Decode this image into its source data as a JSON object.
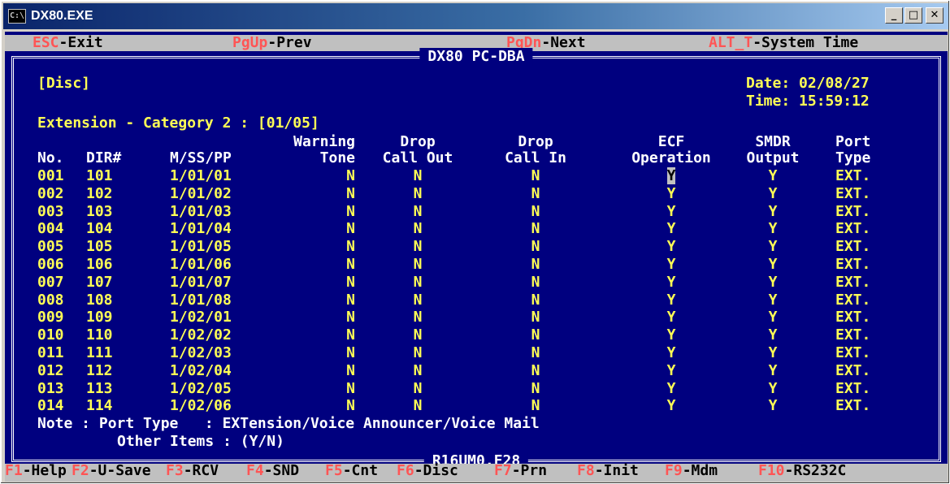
{
  "window": {
    "title": "DX80.EXE",
    "icon": "C:\\"
  },
  "menu": {
    "esc": {
      "key": "ESC",
      "label": "-Exit"
    },
    "pgup": {
      "key": "PgUp",
      "label": "-Prev"
    },
    "pgdn": {
      "key": "PgDn",
      "label": "-Next"
    },
    "alt": {
      "key": "ALT_T",
      "label": "-System Time"
    }
  },
  "screen": {
    "title": "DX80 PC-DBA",
    "mode": "[Disc]",
    "date_label": "Date:",
    "date": "02/08/27",
    "time_label": "Time:",
    "time": "15:59:12",
    "section": "Extension - Category 2 : [01/05]",
    "footer_file": "R16UM0.F28"
  },
  "table": {
    "headers_top": [
      "",
      "",
      "",
      "Warning",
      "Drop",
      "Drop",
      "ECF",
      "SMDR",
      "Port"
    ],
    "headers_bottom": [
      "No.",
      "DIR#",
      "M/SS/PP",
      "Tone",
      "Call Out",
      "Call In",
      "Operation",
      "Output",
      "Type"
    ],
    "rows": [
      [
        "001",
        "101",
        "1/01/01",
        "N",
        "N",
        "N",
        "Y",
        "Y",
        "EXT."
      ],
      [
        "002",
        "102",
        "1/01/02",
        "N",
        "N",
        "N",
        "Y",
        "Y",
        "EXT."
      ],
      [
        "003",
        "103",
        "1/01/03",
        "N",
        "N",
        "N",
        "Y",
        "Y",
        "EXT."
      ],
      [
        "004",
        "104",
        "1/01/04",
        "N",
        "N",
        "N",
        "Y",
        "Y",
        "EXT."
      ],
      [
        "005",
        "105",
        "1/01/05",
        "N",
        "N",
        "N",
        "Y",
        "Y",
        "EXT."
      ],
      [
        "006",
        "106",
        "1/01/06",
        "N",
        "N",
        "N",
        "Y",
        "Y",
        "EXT."
      ],
      [
        "007",
        "107",
        "1/01/07",
        "N",
        "N",
        "N",
        "Y",
        "Y",
        "EXT."
      ],
      [
        "008",
        "108",
        "1/01/08",
        "N",
        "N",
        "N",
        "Y",
        "Y",
        "EXT."
      ],
      [
        "009",
        "109",
        "1/02/01",
        "N",
        "N",
        "N",
        "Y",
        "Y",
        "EXT."
      ],
      [
        "010",
        "110",
        "1/02/02",
        "N",
        "N",
        "N",
        "Y",
        "Y",
        "EXT."
      ],
      [
        "011",
        "111",
        "1/02/03",
        "N",
        "N",
        "N",
        "Y",
        "Y",
        "EXT."
      ],
      [
        "012",
        "112",
        "1/02/04",
        "N",
        "N",
        "N",
        "Y",
        "Y",
        "EXT."
      ],
      [
        "013",
        "113",
        "1/02/05",
        "N",
        "N",
        "N",
        "Y",
        "Y",
        "EXT."
      ],
      [
        "014",
        "114",
        "1/02/06",
        "N",
        "N",
        "N",
        "Y",
        "Y",
        "EXT."
      ]
    ]
  },
  "notes": {
    "line1_label": "Note : Port Type",
    "line1_value": ": EXTension/Voice Announcer/Voice Mail",
    "line2_label": "Other Items",
    "line2_value": ": (Y/N)"
  },
  "fkeys": [
    {
      "key": "F1",
      "label": "-Help"
    },
    {
      "key": "F2",
      "label": "-U-Save"
    },
    {
      "key": "F3",
      "label": "-RCV"
    },
    {
      "key": "F4",
      "label": "-SND"
    },
    {
      "key": "F5",
      "label": "-Cnt"
    },
    {
      "key": "F6",
      "label": "-Disc"
    },
    {
      "key": "F7",
      "label": "-Prn"
    },
    {
      "key": "F8",
      "label": "-Init"
    },
    {
      "key": "F9",
      "label": "-Mdm"
    },
    {
      "key": "F10",
      "label": "-RS232C"
    }
  ],
  "colors": {
    "background": "#00007f",
    "text": "#ffffff",
    "value": "#ffff55",
    "hotkey": "#ff5555",
    "bar": "#c0c0c0"
  }
}
